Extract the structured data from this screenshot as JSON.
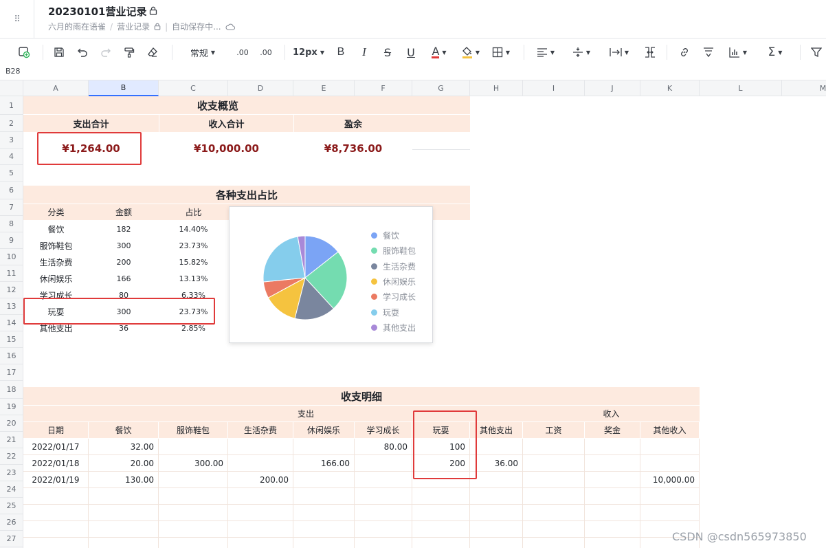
{
  "header": {
    "title": "20230101营业记录",
    "owner": "六月的雨在语雀",
    "book": "营业记录",
    "save_status": "自动保存中..."
  },
  "toolbar": {
    "format": "常规",
    "font_size": "12px",
    "decimal_dec": ".00",
    "decimal_inc": ".00",
    "bold": "B",
    "italic": "I",
    "strike": "S",
    "underline": "U",
    "font_color": "A"
  },
  "name_box": "B28",
  "columns": [
    "A",
    "B",
    "C",
    "D",
    "E",
    "F",
    "G",
    "H",
    "I",
    "J",
    "K",
    "L",
    "M"
  ],
  "rows": [
    "1",
    "2",
    "3",
    "4",
    "5",
    "6",
    "7",
    "8",
    "9",
    "10",
    "11",
    "12",
    "13",
    "14",
    "15",
    "16",
    "17",
    "18",
    "19",
    "20",
    "21",
    "22",
    "23",
    "24",
    "25",
    "26",
    "27"
  ],
  "overview": {
    "title": "收支概览",
    "labels": [
      "支出合计",
      "收入合计",
      "盈余"
    ],
    "values": [
      "¥1,264.00",
      "¥10,000.00",
      "¥8,736.00"
    ]
  },
  "share": {
    "title": "各种支出占比",
    "headers": [
      "分类",
      "金额",
      "占比"
    ],
    "rows": [
      [
        "餐饮",
        "182",
        "14.40%"
      ],
      [
        "服饰鞋包",
        "300",
        "23.73%"
      ],
      [
        "生活杂费",
        "200",
        "15.82%"
      ],
      [
        "休闲娱乐",
        "166",
        "13.13%"
      ],
      [
        "学习成长",
        "80",
        "6.33%"
      ],
      [
        "玩耍",
        "300",
        "23.73%"
      ],
      [
        "其他支出",
        "36",
        "2.85%"
      ]
    ]
  },
  "chart_data": {
    "type": "pie",
    "categories": [
      "餐饮",
      "服饰鞋包",
      "生活杂费",
      "休闲娱乐",
      "学习成长",
      "玩耍",
      "其他支出"
    ],
    "values": [
      182,
      300,
      200,
      166,
      80,
      300,
      36
    ],
    "colors": [
      "#7ba4f5",
      "#74dcb0",
      "#7a869e",
      "#f5c33f",
      "#eb7a62",
      "#85cdec",
      "#a889d8"
    ],
    "legend": "right"
  },
  "detail": {
    "title": "收支明细",
    "group_expense": "支出",
    "group_income": "收入",
    "headers": [
      "日期",
      "餐饮",
      "服饰鞋包",
      "生活杂费",
      "休闲娱乐",
      "学习成长",
      "玩耍",
      "其他支出",
      "工资",
      "奖金",
      "其他收入"
    ],
    "rows": [
      [
        "2022/01/17",
        "32.00",
        "",
        "",
        "",
        "80.00",
        "100",
        "",
        "",
        "",
        ""
      ],
      [
        "2022/01/18",
        "20.00",
        "300.00",
        "",
        "166.00",
        "",
        "200",
        "36.00",
        "",
        "",
        ""
      ],
      [
        "2022/01/19",
        "130.00",
        "",
        "200.00",
        "",
        "",
        "",
        "",
        "",
        "",
        "10,000.00"
      ]
    ]
  },
  "watermark": "CSDN @csdn565973850"
}
